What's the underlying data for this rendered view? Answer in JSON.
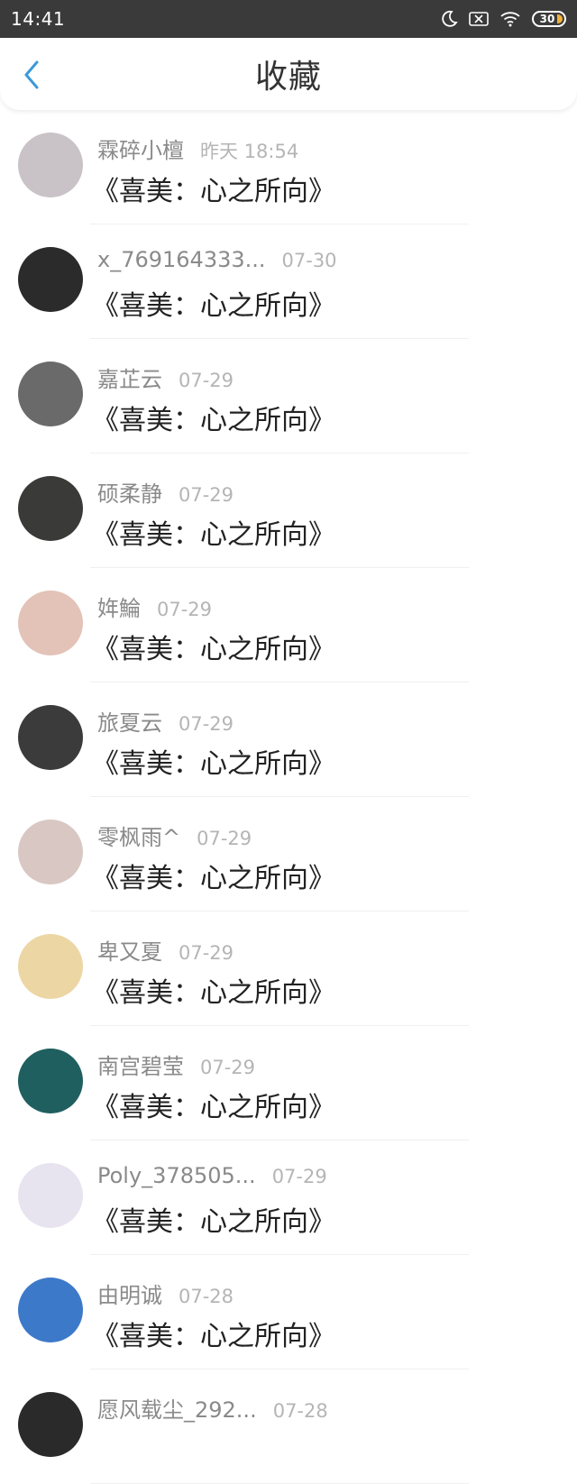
{
  "status_bar": {
    "time": "14:41",
    "battery": "30",
    "icons": [
      "moon-icon",
      "notification-icon",
      "wifi-icon",
      "battery-icon"
    ]
  },
  "nav": {
    "title": "收藏",
    "back_icon": "chevron-left-icon",
    "accent": "#3a9ad9"
  },
  "items": [
    {
      "name": "霖碎小檀",
      "time": "昨天 18:54",
      "title": "《喜美：心之所向》",
      "avatar_color": "#c9c3c7"
    },
    {
      "name": "x_769164333...",
      "time": "07-30",
      "title": "《喜美：心之所向》",
      "avatar_color": "#2b2b2b"
    },
    {
      "name": "嘉芷云",
      "time": "07-29",
      "title": "《喜美：心之所向》",
      "avatar_color": "#6a6a6a"
    },
    {
      "name": "硕柔静",
      "time": "07-29",
      "title": "《喜美：心之所向》",
      "avatar_color": "#3a3a38"
    },
    {
      "name": "姩鯩",
      "time": "07-29",
      "title": "《喜美：心之所向》",
      "avatar_color": "#e3c2b8"
    },
    {
      "name": "旅夏云",
      "time": "07-29",
      "title": "《喜美：心之所向》",
      "avatar_color": "#3b3b3b"
    },
    {
      "name": "零枫雨^",
      "time": "07-29",
      "title": "《喜美：心之所向》",
      "avatar_color": "#d8c7c2"
    },
    {
      "name": "卑又夏",
      "time": "07-29",
      "title": "《喜美：心之所向》",
      "avatar_color": "#ecd6a4"
    },
    {
      "name": "南宫碧莹",
      "time": "07-29",
      "title": "《喜美：心之所向》",
      "avatar_color": "#1f5f5f"
    },
    {
      "name": "Poly_378505...",
      "time": "07-29",
      "title": "《喜美：心之所向》",
      "avatar_color": "#e7e4ef"
    },
    {
      "name": "由明诚",
      "time": "07-28",
      "title": "《喜美：心之所向》",
      "avatar_color": "#3d79c9"
    },
    {
      "name": "愿风载尘_292...",
      "time": "07-28",
      "title": "",
      "avatar_color": "#2a2a2a"
    }
  ]
}
